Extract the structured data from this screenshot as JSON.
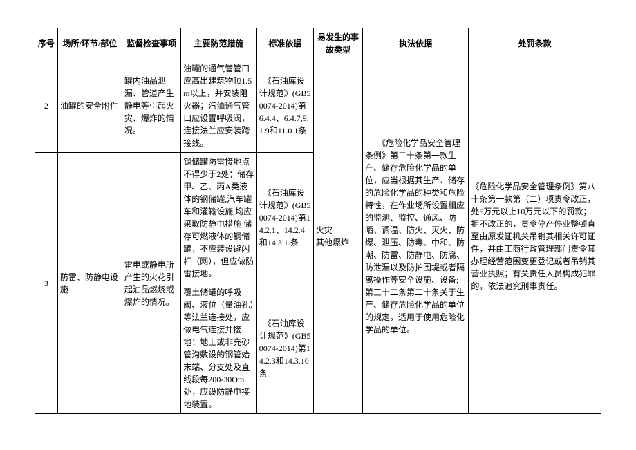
{
  "headers": {
    "seq": "序号",
    "place": "场所/环节/部位",
    "inspect": "监督检查事项",
    "measure": "主要防范措施",
    "standard": "标准依据",
    "accident": "易发生的事故类型",
    "enforce": "执法依据",
    "penalty": "处罚条款"
  },
  "rows": {
    "r2": {
      "seq": "2",
      "place": "油罐的安全附件",
      "inspect": "罐内油品泄漏、管道产生静电等引起火灾、爆炸的情况。",
      "measure": "油罐的通气管管口应高出建筑物顶1.5m以上，并安装阻火器；汽油通气管口应设置呼吸阀，连接法兰应安装跨接线。",
      "standard": "　《石油库设计规范》(GB50074-2014)第6.4.4、6.4.7,9.1.9和11.0.1条"
    },
    "r3": {
      "seq": "3",
      "place": "防雷、防静电设施",
      "inspect": "雷电或静电所产生的火花引起油品燃烧或爆炸的情况。",
      "measure_a": "钢储罐防雷接地点不得少于2处；储存甲、乙、丙A类液体的钢储罐,汽车罐车和灌输设施,均应采取防静电措施 储存可燃液体的钢储罐，不应装设避闪杆（网），但应做防雷接地。",
      "standard_a": "　《石油库设计规范》(GB50074-2014)第14.2.1、14.2.4和14.3.1.条",
      "measure_b": "覆土储罐的呼吸阀、液位（量油孔）等法兰连接处，应做电气连接并接地；地上或非充砂管沟敷设的钢管始末端、分支处及直线段每200-30Om处，应设防静电接地装置。",
      "standard_b": "　《石油库设计规范》(GB50074-2014)第14.2.3和14.3.10条"
    },
    "shared": {
      "accident": "火灾\n其他爆炸",
      "enforce": "　　《危险化学品安全管理条例》第二十条第一款生产、储存危险化学品的单位，应当根据其生产、储存的危险化学品的种类和危险特性，在作业场所设置相应的监测、监控、通风、防晒、调温、防火、灭火、防爆、泄压、防毒、中和、防潮、防雷、防静电、防腐、防泄漏以及防护围堤或者隔离操作等安全设施、设备; 第三十二条第二十条关于生产、储存危险化学品的单位的规定，适用于使用危险化学品的单位。",
      "penalty": "《危险化学品安全管理条例》第八十条第一款第（二）项责令改正，处5万元以上10万元以下的罚款；拒不改正的，责令停产停业整顿直至由原发证机关吊销其相关许可证件，并由工商行政管理部门责令其办理经营范围变更登记或者吊销其营业执照；有关责任人员构成犯罪的，依法追究刑事责任。"
    }
  }
}
